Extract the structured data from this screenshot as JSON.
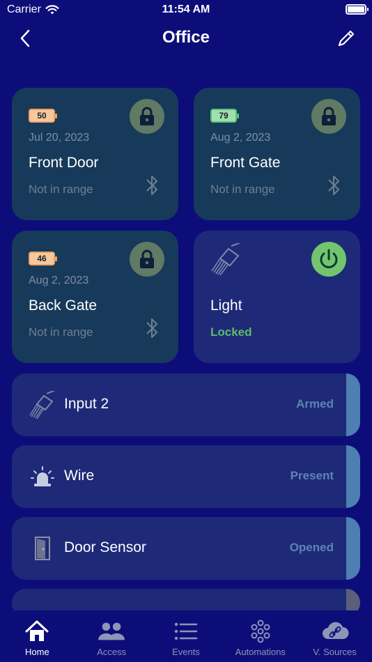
{
  "status_bar": {
    "carrier": "Carrier",
    "time": "11:54 AM"
  },
  "nav": {
    "title": "Office"
  },
  "locks": [
    {
      "battery": "50",
      "battery_color": "#f0a060",
      "date": "Jul 20, 2023",
      "name": "Front Door",
      "status": "Not in range"
    },
    {
      "battery": "79",
      "battery_color": "#5cc07a",
      "date": "Aug 2, 2023",
      "name": "Front Gate",
      "status": "Not in range"
    },
    {
      "battery": "46",
      "battery_color": "#f0a060",
      "date": "Aug 2, 2023",
      "name": "Back Gate",
      "status": "Not in range"
    }
  ],
  "switch": {
    "name": "Light",
    "status": "Locked",
    "status_color": "#5dbb6a"
  },
  "rows": [
    {
      "label": "Input 2",
      "value": "Armed",
      "icon": "plug-icon"
    },
    {
      "label": "Wire",
      "value": "Present",
      "icon": "siren-icon"
    },
    {
      "label": "Door Sensor",
      "value": "Opened",
      "icon": "door-icon"
    }
  ],
  "tabs": [
    {
      "label": "Home",
      "icon": "home-icon",
      "active": true
    },
    {
      "label": "Access",
      "icon": "people-icon"
    },
    {
      "label": "Events",
      "icon": "list-icon"
    },
    {
      "label": "Automations",
      "icon": "automations-icon"
    },
    {
      "label": "V. Sources",
      "icon": "cloud-link-icon"
    }
  ],
  "colors": {
    "background": "#0d0d7a",
    "lock_card": "#173a5a",
    "switch_card": "#1e2a78",
    "row_accent": "#4d7fb3"
  }
}
